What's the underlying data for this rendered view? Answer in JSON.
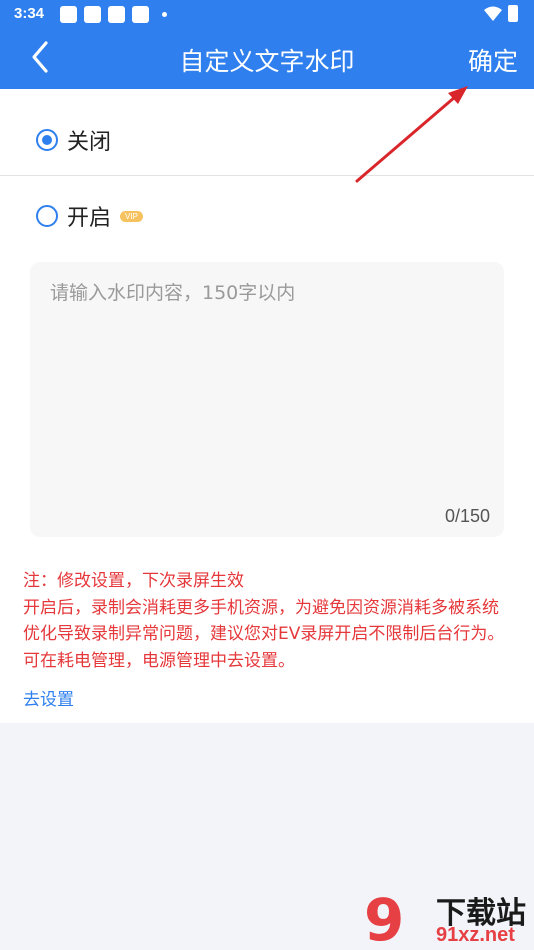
{
  "status_bar": {
    "time": "3:34"
  },
  "header": {
    "title": "自定义文字水印",
    "confirm_label": "确定"
  },
  "options": {
    "off_label": "关闭",
    "off_selected": true,
    "on_label": "开启",
    "on_selected": false,
    "vip_badge": "VIP"
  },
  "watermark_input": {
    "placeholder": "请输入水印内容，150字以内",
    "counter": "0/150"
  },
  "notice": {
    "line1": "注：修改设置，下次录屏生效",
    "line2": "开启后，录制会消耗更多手机资源，为避免因资源消耗多被系统优化导致录制异常问题，建议您对EV录屏开启不限制后台行为。可在耗电管理，电源管理中去设置。",
    "link": "去设置"
  },
  "site_watermark": {
    "logo_text": "9",
    "top": "下载站",
    "bottom": "91xz.net"
  },
  "colors": {
    "primary": "#2f80ee",
    "warning_text": "#e5383b",
    "annotation_arrow": "#d9262b"
  }
}
